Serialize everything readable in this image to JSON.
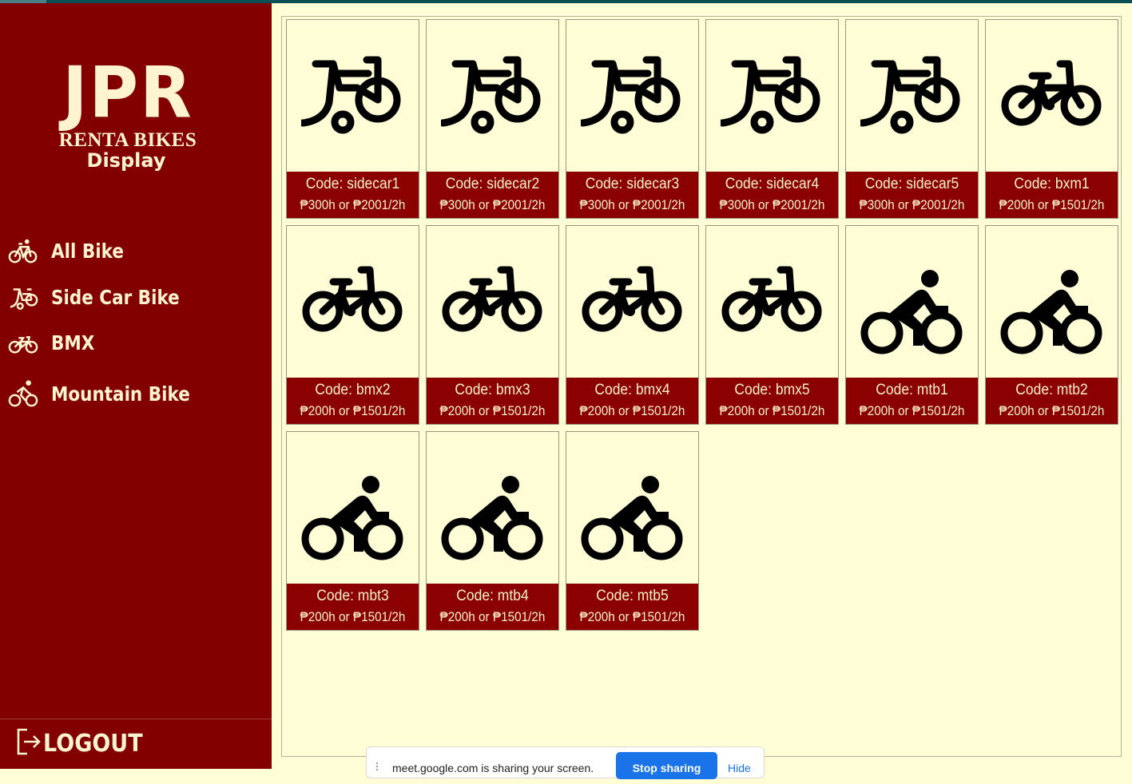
{
  "brand": {
    "name": "JPR",
    "subtitle": "RENTA BIKES",
    "section": "Display"
  },
  "nav": [
    {
      "label": "All Bike",
      "icon": "bicycle-icon"
    },
    {
      "label": "Side Car Bike",
      "icon": "sidecar-bike-icon"
    },
    {
      "label": "BMX",
      "icon": "bmx-icon"
    },
    {
      "label": "Mountain Bike",
      "icon": "mountain-bike-icon"
    }
  ],
  "logout": {
    "label": "LOGOUT",
    "icon": "logout-icon"
  },
  "bikes": [
    {
      "code": "Code: sidecar1",
      "price": "₱300h  or  ₱2001/2h",
      "type": "sidecar"
    },
    {
      "code": "Code: sidecar2",
      "price": "₱300h  or  ₱2001/2h",
      "type": "sidecar"
    },
    {
      "code": "Code: sidecar3",
      "price": "₱300h  or  ₱2001/2h",
      "type": "sidecar"
    },
    {
      "code": "Code: sidecar4",
      "price": "₱300h  or  ₱2001/2h",
      "type": "sidecar"
    },
    {
      "code": "Code: sidecar5",
      "price": "₱300h  or  ₱2001/2h",
      "type": "sidecar"
    },
    {
      "code": "Code: bxm1",
      "price": "₱200h  or  ₱1501/2h",
      "type": "bmx"
    },
    {
      "code": "Code: bmx2",
      "price": "₱200h  or  ₱1501/2h",
      "type": "bmx"
    },
    {
      "code": "Code: bmx3",
      "price": "₱200h  or  ₱1501/2h",
      "type": "bmx"
    },
    {
      "code": "Code: bmx4",
      "price": "₱200h  or  ₱1501/2h",
      "type": "bmx"
    },
    {
      "code": "Code: bmx5",
      "price": "₱200h  or  ₱1501/2h",
      "type": "bmx"
    },
    {
      "code": "Code: mtb1",
      "price": "₱200h  or  ₱1501/2h",
      "type": "mtb"
    },
    {
      "code": "Code: mtb2",
      "price": "₱200h  or  ₱1501/2h",
      "type": "mtb"
    },
    {
      "code": "Code: mbt3",
      "price": "₱200h  or  ₱1501/2h",
      "type": "mtb"
    },
    {
      "code": "Code: mtb4",
      "price": "₱200h  or  ₱1501/2h",
      "type": "mtb"
    },
    {
      "code": "Code: mtb5",
      "price": "₱200h  or  ₱1501/2h",
      "type": "mtb"
    }
  ],
  "share_bar": {
    "message": "meet.google.com is sharing your screen.",
    "stop_label": "Stop sharing",
    "hide_label": "Hide"
  },
  "colors": {
    "sidebar": "#820000",
    "card_info": "#8b0000",
    "background": "#fffdd6",
    "text_light": "#fff4cf"
  }
}
